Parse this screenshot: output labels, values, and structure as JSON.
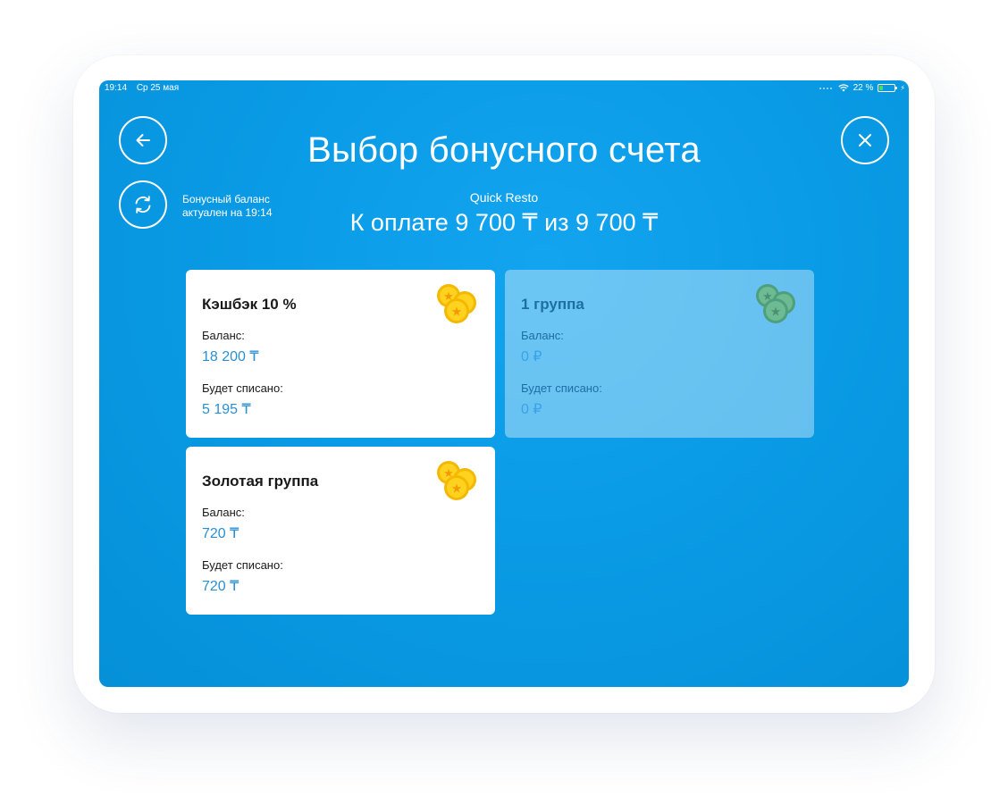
{
  "status_bar": {
    "time": "19:14",
    "date": "Ср 25 мая",
    "battery_percent": "22 %",
    "battery_level": 0.22
  },
  "header": {
    "title": "Выбор бонусного счета",
    "refresh_note_line1": "Бонусный баланс",
    "refresh_note_line2": "актуален на 19:14",
    "organization": "Quick Resto",
    "to_pay": "К оплате 9 700 ₸ из 9 700 ₸"
  },
  "icons": {
    "back": "arrow-left-icon",
    "close": "close-icon",
    "refresh": "refresh-icon",
    "coins": "coins-icon"
  },
  "colors": {
    "background": "#0a9be6",
    "value": "#2a8fd2",
    "coin_gold": "#f7c600",
    "coin_green": "#5cb08a"
  },
  "cards": [
    {
      "name": "Кэшбэк 10 %",
      "balance_label": "Баланс:",
      "balance": "18 200 ₸",
      "deduct_label": "Будет списано:",
      "deduct": "5 195 ₸",
      "enabled": true
    },
    {
      "name": "1 группа",
      "balance_label": "Баланс:",
      "balance": "0 ₽",
      "deduct_label": "Будет списано:",
      "deduct": "0 ₽",
      "enabled": false
    },
    {
      "name": "Золотая группа",
      "balance_label": "Баланс:",
      "balance": "720 ₸",
      "deduct_label": "Будет списано:",
      "deduct": "720 ₸",
      "enabled": true
    }
  ]
}
